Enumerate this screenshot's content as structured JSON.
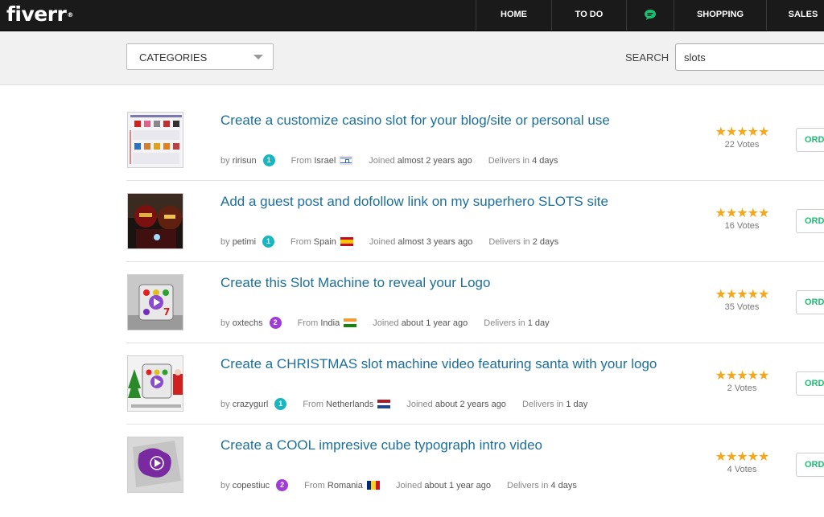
{
  "nav": {
    "logo": "fiverr",
    "logo_mark": "®",
    "items": [
      "HOME",
      "TO DO",
      "SHOPPING",
      "SALES"
    ],
    "chat_icon": "chat-bubble-icon"
  },
  "search": {
    "category_label": "CATEGORIES",
    "label": "SEARCH",
    "query": "slots"
  },
  "colors": {
    "title": "#1d6f9b",
    "order_text": "#1dbf73",
    "star": "#f2a81d",
    "level_1": "#17b6c0",
    "level_2": "#a03bd6"
  },
  "gigs": [
    {
      "title": "Create a customize casino slot for your blog/site or personal use",
      "by": "by",
      "seller": "ririsun",
      "level": "1",
      "from": "From",
      "country": "Israel",
      "joined_prefix": "Joined",
      "joined": "almost 2 years ago",
      "delivers_prefix": "Delivers in",
      "delivers": "4 days",
      "rating": 5,
      "votes": "22 Votes",
      "order": "ORD"
    },
    {
      "title": "Add a guest post and dofollow link on my superhero SLOTS site",
      "by": "by",
      "seller": "petimi",
      "level": "1",
      "from": "From",
      "country": "Spain",
      "joined_prefix": "Joined",
      "joined": "almost 3 years ago",
      "delivers_prefix": "Delivers in",
      "delivers": "2 days",
      "rating": 5,
      "votes": "16 Votes",
      "order": "ORD"
    },
    {
      "title": "Create this Slot Machine to reveal your Logo",
      "by": "by",
      "seller": "oxtechs",
      "level": "2",
      "from": "From",
      "country": "India",
      "joined_prefix": "Joined",
      "joined": "about 1 year ago",
      "delivers_prefix": "Delivers in",
      "delivers": "1 day",
      "rating": 5,
      "votes": "35 Votes",
      "order": "ORD"
    },
    {
      "title": "Create a CHRISTMAS slot machine video featuring santa with your logo",
      "by": "by",
      "seller": "crazygurl",
      "level": "1",
      "from": "From",
      "country": "Netherlands",
      "joined_prefix": "Joined",
      "joined": "about 2 years ago",
      "delivers_prefix": "Delivers in",
      "delivers": "1 day",
      "rating": 5,
      "votes": "2 Votes",
      "order": "ORD"
    },
    {
      "title": "Create a COOL impresive cube typograph intro video",
      "by": "by",
      "seller": "copestiuc",
      "level": "2",
      "from": "From",
      "country": "Romania",
      "joined_prefix": "Joined",
      "joined": "about 1 year ago",
      "delivers_prefix": "Delivers in",
      "delivers": "4 days",
      "rating": 5,
      "votes": "4 Votes",
      "order": "ORD"
    }
  ]
}
